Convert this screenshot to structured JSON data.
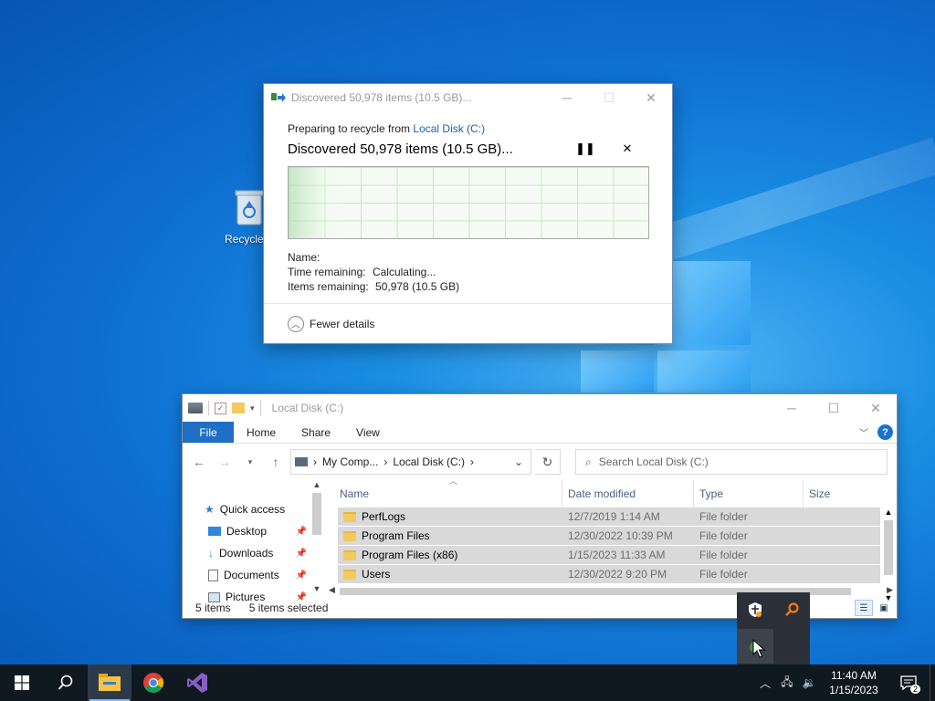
{
  "desktop": {
    "icons": [
      {
        "label": "Recycle B"
      }
    ]
  },
  "copy_dialog": {
    "title": "Discovered 50,978 items (10.5 GB)...",
    "subtitle_prefix": "Preparing to recycle from ",
    "subtitle_link": "Local Disk (C:)",
    "heading": "Discovered 50,978 items (10.5 GB)...",
    "name_label": "Name:",
    "time_label": "Time remaining:",
    "time_value": "Calculating...",
    "items_label": "Items remaining:",
    "items_value": "50,978 (10.5 GB)",
    "details_toggle": "Fewer details"
  },
  "explorer": {
    "title": "Local Disk (C:)",
    "ribbon_tabs": [
      "File",
      "Home",
      "Share",
      "View"
    ],
    "breadcrumb": [
      "My Comp...",
      "Local Disk (C:)"
    ],
    "search_placeholder": "Search Local Disk (C:)",
    "nav": {
      "quick_access": "Quick access",
      "items": [
        "Desktop",
        "Downloads",
        "Documents",
        "Pictures"
      ]
    },
    "columns": [
      "Name",
      "Date modified",
      "Type",
      "Size"
    ],
    "rows": [
      {
        "name": "PerfLogs",
        "date": "12/7/2019 1:14 AM",
        "type": "File folder"
      },
      {
        "name": "Program Files",
        "date": "12/30/2022 10:39 PM",
        "type": "File folder"
      },
      {
        "name": "Program Files (x86)",
        "date": "1/15/2023 11:33 AM",
        "type": "File folder"
      },
      {
        "name": "Users",
        "date": "12/30/2022 9:20 PM",
        "type": "File folder"
      }
    ],
    "status": {
      "count": "5 items",
      "selected": "5 items selected"
    }
  },
  "taskbar": {
    "time": "11:40 AM",
    "date": "1/15/2023",
    "notification_count": "2"
  },
  "colors": {
    "accent": "#1f6fc5",
    "taskbar": "#101820",
    "desktop": "#0e6fd0",
    "link": "#1a5fb4"
  }
}
